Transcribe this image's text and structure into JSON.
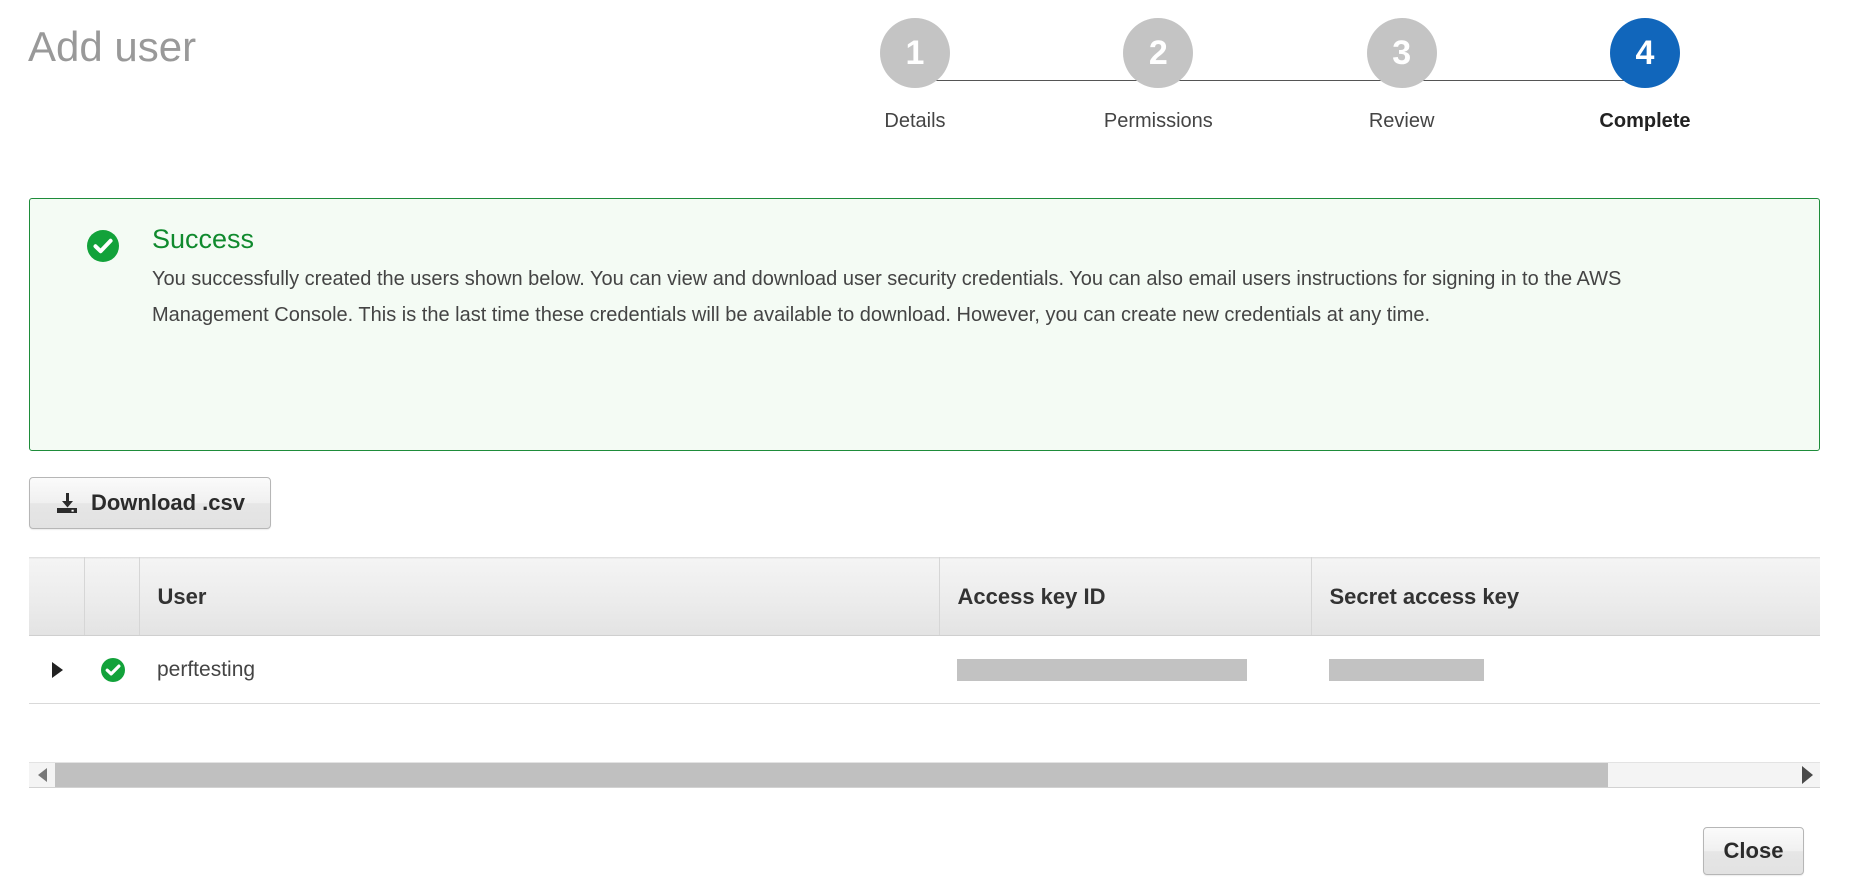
{
  "page": {
    "title": "Add user"
  },
  "stepper": {
    "steps": [
      {
        "number": "1",
        "label": "Details",
        "active": false
      },
      {
        "number": "2",
        "label": "Permissions",
        "active": false
      },
      {
        "number": "3",
        "label": "Review",
        "active": false
      },
      {
        "number": "4",
        "label": "Complete",
        "active": true
      }
    ],
    "active_color": "#1166bb",
    "inactive_color": "#c4c4c4"
  },
  "alert": {
    "icon": "check-circle-icon",
    "title": "Success",
    "message": "You successfully created the users shown below. You can view and download user security credentials. You can also email users instructions for signing in to the AWS Management Console. This is the last time these credentials will be available to download. However, you can create new credentials at any time.",
    "border_color": "#1e8c3a",
    "background_color": "#f4fbf4",
    "title_color": "#108a2e"
  },
  "toolbar": {
    "download_label": "Download .csv",
    "download_icon": "download-icon"
  },
  "table": {
    "columns": [
      "",
      "",
      "User",
      "Access key ID",
      "Secret access key"
    ],
    "rows": [
      {
        "expand_icon": "caret-right-icon",
        "status_icon": "check-circle-icon",
        "user": "perftesting",
        "access_key_id": "",
        "secret_access_key": "",
        "access_key_id_masked": true,
        "secret_access_key_masked": true
      }
    ]
  },
  "scrollbar": {
    "left_arrow_icon": "arrow-left-icon",
    "right_arrow_icon": "arrow-right-icon",
    "thumb_color": "#c0c0c0"
  },
  "footer": {
    "close_label": "Close"
  }
}
